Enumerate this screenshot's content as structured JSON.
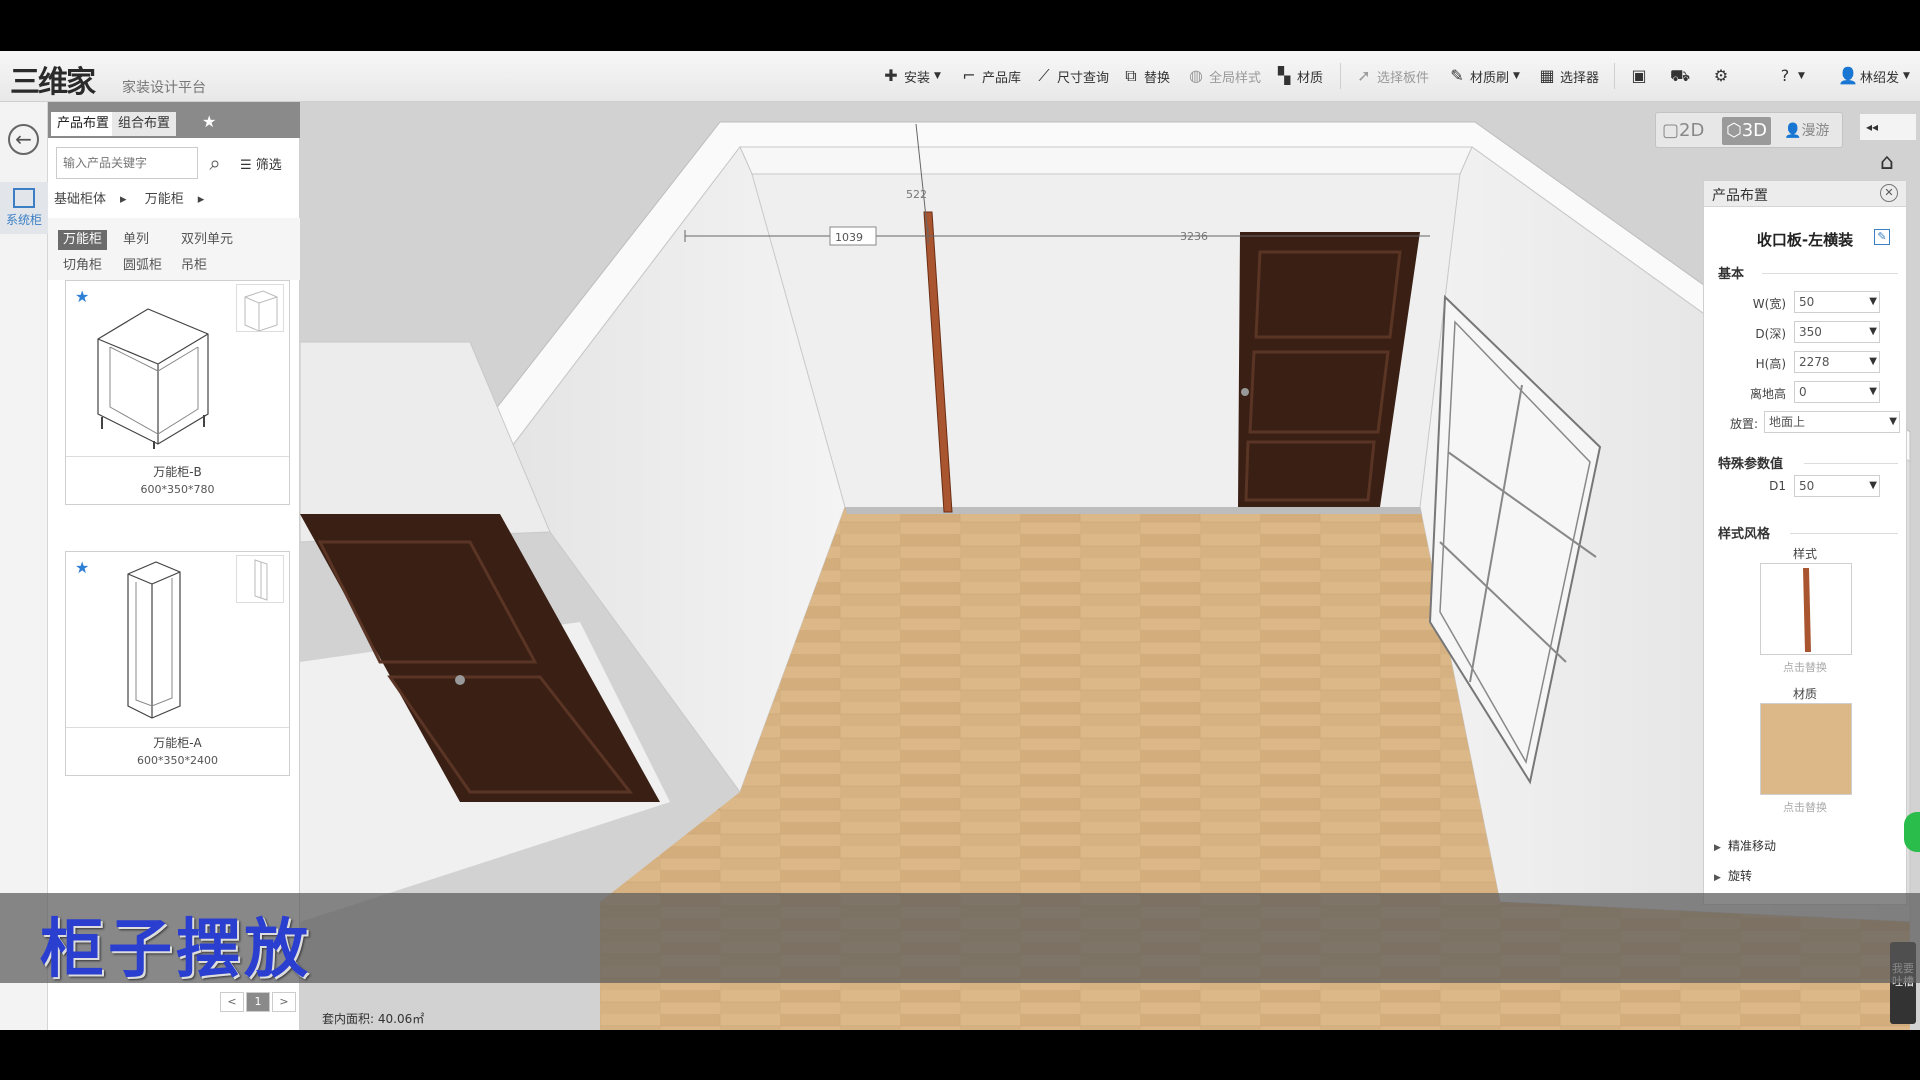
{
  "app": {
    "logo_text": "三维家",
    "subtitle": "家装设计平台"
  },
  "toolbar": {
    "install": "安装",
    "product_lib": "产品库",
    "size_query": "尺寸查询",
    "replace": "替换",
    "full_style": "全局样式",
    "material": "材质",
    "select_board": "选择板件",
    "material_brush": "材质刷",
    "selector": "选择器",
    "user": "林绍发"
  },
  "rail": {
    "system_cabinet": "系统柜"
  },
  "panel": {
    "tabs": [
      "产品布置",
      "组合布置"
    ],
    "search_placeholder": "输入产品关键字",
    "filter": "筛选",
    "breadcrumb": [
      "基础柜体",
      "万能柜"
    ],
    "categories": [
      "万能柜",
      "单列",
      "双列单元",
      "切角柜",
      "圆弧柜",
      "吊柜"
    ],
    "products": [
      {
        "name": "万能柜-B",
        "size": "600*350*780"
      },
      {
        "name": "万能柜-A",
        "size": "600*350*2400"
      }
    ],
    "pager": [
      "<",
      "1",
      ">"
    ]
  },
  "viewport": {
    "view_modes": [
      "2D",
      "3D",
      "漫游"
    ],
    "dim_labels": [
      "522",
      "1039",
      "3236"
    ],
    "area": "套内面积: 40.06㎡"
  },
  "props": {
    "title": "产品布置",
    "item_name": "收口板-左横装",
    "basic_section": "基本",
    "fields": [
      {
        "label": "W(宽)",
        "value": "50"
      },
      {
        "label": "D(深)",
        "value": "350"
      },
      {
        "label": "H(高)",
        "value": "2278"
      },
      {
        "label": "离地高",
        "value": "0"
      }
    ],
    "placement_label": "放置:",
    "placement_value": "地面上",
    "special_section": "特殊参数值",
    "special_fields": [
      {
        "label": "D1",
        "value": "50"
      }
    ],
    "style_section": "样式风格",
    "style_label": "样式",
    "material_label": "材质",
    "click_replace": "点击替换",
    "tree": [
      "精准移动",
      "旋转"
    ]
  },
  "caption": "柜子摆放",
  "feedback": "我要吐槽",
  "colors": {
    "accent": "#2e7fd6",
    "caption": "#2a3fd0",
    "door": "#3a1f14",
    "floor": "#d9b585",
    "panel_wood": "#a9552f"
  }
}
